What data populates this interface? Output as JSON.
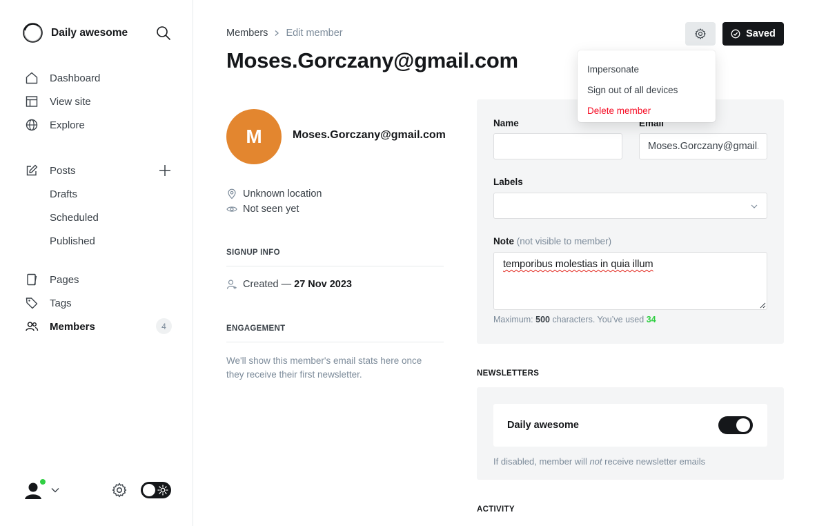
{
  "sidebar": {
    "site_name": "Daily awesome",
    "nav": [
      {
        "label": "Dashboard",
        "icon": "home-icon"
      },
      {
        "label": "View site",
        "icon": "layout-icon"
      },
      {
        "label": "Explore",
        "icon": "globe-icon"
      }
    ],
    "posts": {
      "label": "Posts",
      "sub": [
        "Drafts",
        "Scheduled",
        "Published"
      ]
    },
    "content_nav": [
      {
        "label": "Pages",
        "icon": "pages-icon"
      },
      {
        "label": "Tags",
        "icon": "tag-icon"
      },
      {
        "label": "Members",
        "icon": "members-icon",
        "count": "4",
        "active": true
      }
    ]
  },
  "header": {
    "breadcrumb_parent": "Members",
    "breadcrumb_current": "Edit member",
    "title": "Moses.Gorczany@gmail.com",
    "saved_label": "Saved"
  },
  "menu": {
    "items": [
      "Impersonate",
      "Sign out of all devices",
      "Delete member"
    ]
  },
  "member": {
    "initial": "M",
    "email": "Moses.Gorczany@gmail.com",
    "location": "Unknown location",
    "seen": "Not seen yet",
    "avatar_color": "#e3862f"
  },
  "signup": {
    "section_title": "SIGNUP INFO",
    "created_label": "Created —",
    "created_date": "27 Nov 2023"
  },
  "engagement": {
    "section_title": "ENGAGEMENT",
    "text": "We'll show this member's email stats here once they receive their first newsletter."
  },
  "form": {
    "name_label": "Name",
    "name_value": "",
    "email_label": "Email",
    "email_value": "Moses.Gorczany@gmail.com",
    "labels_label": "Labels",
    "note_label": "Note",
    "note_hint": "(not visible to member)",
    "note_value": "temporibus molestias in quia illum",
    "count_prefix": "Maximum:",
    "count_max": "500",
    "count_middle": "characters. You’ve used",
    "count_used": "34"
  },
  "newsletters": {
    "section_title": "NEWSLETTERS",
    "name": "Daily awesome",
    "enabled": true,
    "note_before": "If disabled, member will",
    "note_em": "not",
    "note_after": "receive newsletter emails"
  },
  "activity": {
    "section_title": "ACTIVITY"
  },
  "colors": {
    "accent_green": "#30cf43",
    "danger": "#f50b23",
    "dark": "#15171a"
  }
}
